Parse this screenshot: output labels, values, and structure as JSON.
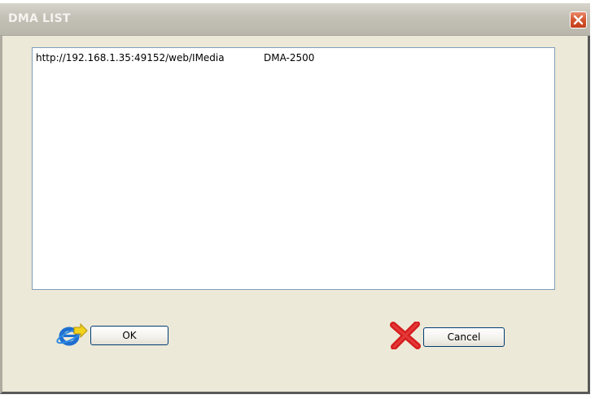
{
  "window": {
    "title": "DMA LIST"
  },
  "list": {
    "rows": [
      {
        "url": "http://192.168.1.35:49152/web/IMedia",
        "name": "DMA-2500"
      }
    ]
  },
  "buttons": {
    "ok_label": "OK",
    "cancel_label": "Cancel"
  },
  "icons": {
    "close": "close-icon",
    "ok": "internet-explorer-icon",
    "cancel": "red-x-icon"
  },
  "colors": {
    "close_button": "#d4552f",
    "cancel_x": "#d61e1e",
    "ie_blue": "#1e6fd0",
    "ie_arrow": "#f2d21b"
  }
}
